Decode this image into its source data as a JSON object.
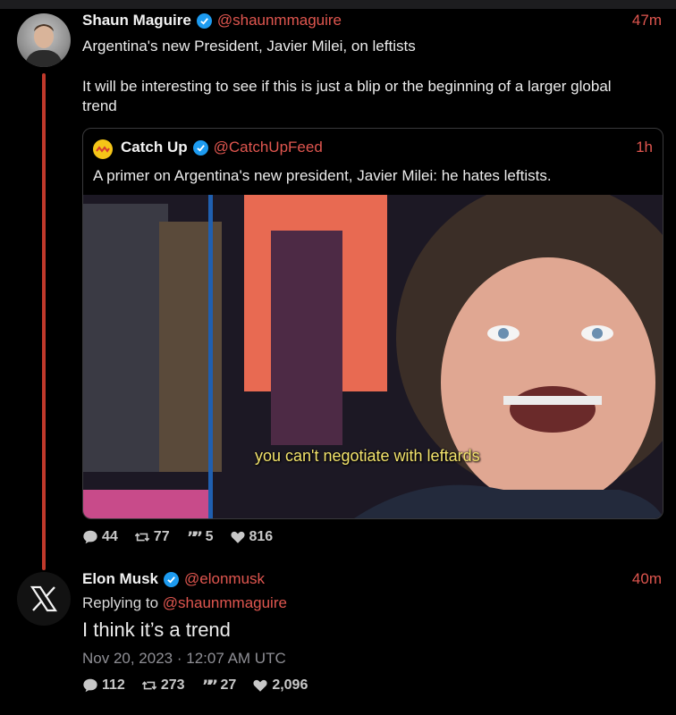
{
  "tweet": {
    "author_name": "Shaun Maguire",
    "author_handle": "@shaunmmaguire",
    "time": "47m",
    "text_line1": "Argentina's new President, Javier Milei, on leftists",
    "text_line2": "It will be interesting to see if this is just a blip or the beginning of a larger global trend",
    "quote": {
      "author_name": "Catch Up",
      "author_handle": "@CatchUpFeed",
      "time": "1h",
      "text": "A primer on Argentina's new president, Javier Milei: he hates leftists.",
      "media_subtitle": "you can't negotiate with leftards"
    },
    "stats": {
      "replies": "44",
      "retweets": "77",
      "quotes": "5",
      "likes": "816"
    }
  },
  "reply": {
    "author_name": "Elon Musk",
    "author_handle": "@elonmusk",
    "time": "40m",
    "replying_to_label": "Replying to",
    "replying_to_handle": "@shaunmmaguire",
    "text": "I think it’s a trend",
    "date": "Nov 20, 2023 · 12:07 AM UTC",
    "stats": {
      "replies": "112",
      "retweets": "273",
      "quotes": "27",
      "likes": "2,096"
    }
  },
  "colors": {
    "accent": "#e0564f",
    "verified": "#1d9bf0",
    "thread_line": "#c0392b"
  }
}
